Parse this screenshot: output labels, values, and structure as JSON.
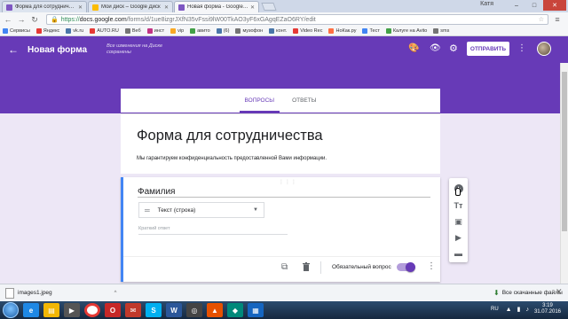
{
  "browser": {
    "tabs": [
      {
        "title": "Форма для сотрудничест...",
        "favicon_color": "#7e57c2",
        "active": false
      },
      {
        "title": "Мой диск – Google Диск",
        "favicon_color": "#fbbc04",
        "active": false
      },
      {
        "title": "Новая форма - Google Ф...",
        "favicon_color": "#7e57c2",
        "active": true
      }
    ],
    "user_label": "Катя",
    "url_scheme": "https://",
    "url_domain": "docs.google.com",
    "url_path": "/forms/d/1ue8izgrJXfN35vFssi9lW00TkAO3yF6xGAgqEZaO6RY/edit",
    "bookmarks": [
      {
        "label": "Сервисы",
        "color": "#4285f4"
      },
      {
        "label": "Яндекс",
        "color": "#e53935"
      },
      {
        "label": "vk.ru",
        "color": "#4a76a8"
      },
      {
        "label": "AUTO.RU",
        "color": "#e53935"
      },
      {
        "label": "Веб",
        "color": "#757575"
      },
      {
        "label": "инст",
        "color": "#c13584"
      },
      {
        "label": "vip",
        "color": "#f9a825"
      },
      {
        "label": "авито",
        "color": "#43a047"
      },
      {
        "label": "(6)",
        "color": "#4a76a8"
      },
      {
        "label": "музофон",
        "color": "#757575"
      },
      {
        "label": "конт.",
        "color": "#4a76a8"
      },
      {
        "label": "Video Rec",
        "color": "#e53935"
      },
      {
        "label": "НоКак.ру",
        "color": "#ff7043"
      },
      {
        "label": "Тест",
        "color": "#4285f4"
      },
      {
        "label": "Калуге на Avito",
        "color": "#43a047"
      },
      {
        "label": "sms",
        "color": "#757575"
      }
    ]
  },
  "header": {
    "form_title": "Новая форма",
    "saved_status": "Все изменения на Диске сохранены",
    "send_label": "ОТПРАВИТЬ",
    "accent_color": "#673ab7"
  },
  "tabs": {
    "questions": "ВОПРОСЫ",
    "responses": "ОТВЕТЫ"
  },
  "form": {
    "title": "Форма для сотрудничества",
    "description": "Мы гарантируем конфиденциальность предоставленной Вами информации."
  },
  "question": {
    "title": "Фамилия",
    "type": "Текст (строка)",
    "answer_placeholder": "Краткий ответ",
    "required_label": "Обязательный вопрос",
    "required": true
  },
  "downloads": {
    "file_name": "images1.jpeg",
    "show_all": "Все скачанные файлы"
  },
  "taskbar": {
    "lang": "RU",
    "time": "3:19",
    "date": "31.07.2016"
  }
}
